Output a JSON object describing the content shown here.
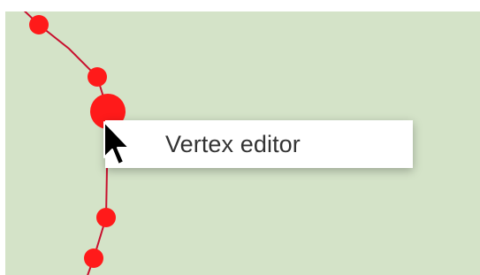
{
  "map": {
    "background_color": "#d4e3c8",
    "line_color": "#c8102e",
    "vertex_color": "#ff1a1a",
    "selected_vertex_color": "#ff1a1a"
  },
  "context_menu": {
    "items": [
      {
        "label": "Vertex editor"
      }
    ]
  },
  "cursor": {
    "icon": "arrow-pointer-icon"
  }
}
